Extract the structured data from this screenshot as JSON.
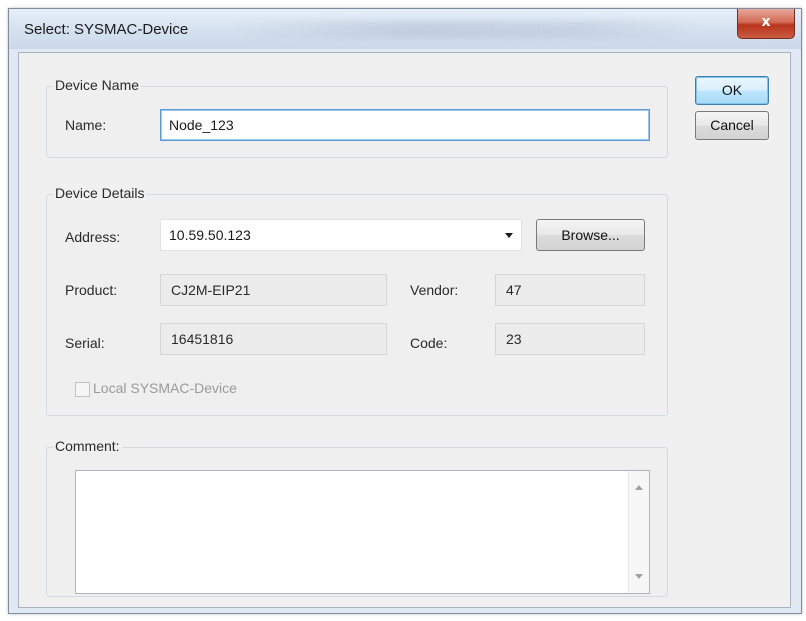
{
  "window": {
    "title": "Select: SYSMAC-Device",
    "close_label": "x"
  },
  "buttons": {
    "ok": "OK",
    "cancel": "Cancel",
    "browse": "Browse..."
  },
  "device_name": {
    "group_label": "Device Name",
    "name_label": "Name:",
    "name_value": "Node_123"
  },
  "device_details": {
    "group_label": "Device Details",
    "address_label": "Address:",
    "address_value": "10.59.50.123",
    "address_dropdown_icon": "chevron-down-icon",
    "product_label": "Product:",
    "product_value": "CJ2M-EIP21",
    "vendor_label": "Vendor:",
    "vendor_value": "47",
    "serial_label": "Serial:",
    "serial_value": "16451816",
    "code_label": "Code:",
    "code_value": "23",
    "local_device_label": "Local SYSMAC-Device",
    "local_device_checked": false,
    "local_device_enabled": false
  },
  "comment": {
    "group_label": "Comment:",
    "value": ""
  },
  "colors": {
    "close_button": "#c8442b",
    "default_button_border": "#3c7fb1",
    "dialog_background": "#f0f0f0"
  }
}
